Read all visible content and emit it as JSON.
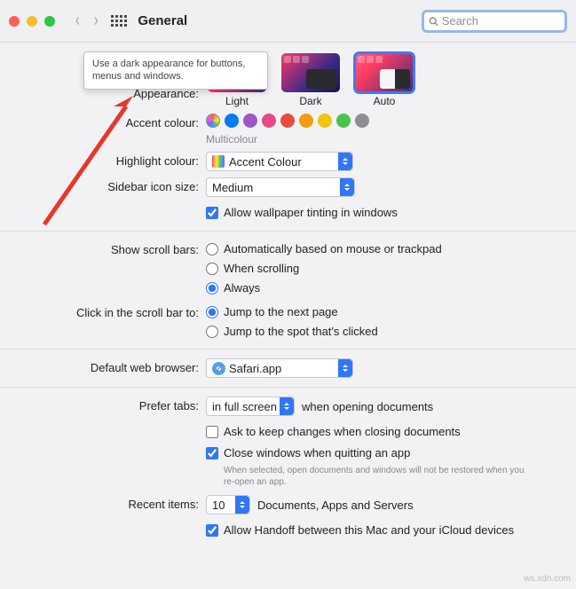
{
  "titlebar": {
    "title": "General"
  },
  "search": {
    "placeholder": "Search"
  },
  "tooltip": "Use a dark appearance for buttons, menus and windows.",
  "labels": {
    "appearance": "Appearance:",
    "accent": "Accent colour:",
    "highlight": "Highlight colour:",
    "iconsize": "Sidebar icon size:",
    "scrollbars": "Show scroll bars:",
    "click": "Click in the scroll bar to:",
    "browser": "Default web browser:",
    "tabs": "Prefer tabs:",
    "recent": "Recent items:"
  },
  "appearance": {
    "light": "Light",
    "dark": "Dark",
    "auto": "Auto"
  },
  "accent_subtext": "Multicolour",
  "highlight_value": "Accent Colour",
  "iconsize_value": "Medium",
  "chk": {
    "wallpaper": "Allow wallpaper tinting in windows",
    "ask": "Ask to keep changes when closing documents",
    "close_windows": "Close windows when quitting an app",
    "close_sub": "When selected, open documents and windows will not be restored when you re-open an app.",
    "handoff": "Allow Handoff between this Mac and your iCloud devices"
  },
  "scroll": {
    "auto": "Automatically based on mouse or trackpad",
    "scrolling": "When scrolling",
    "always": "Always"
  },
  "clickopts": {
    "jump_next": "Jump to the next page",
    "jump_spot": "Jump to the spot that's clicked"
  },
  "browser_value": "Safari.app",
  "tabs_value": "in full screen",
  "tabs_after": "when opening documents",
  "recent_value": "10",
  "recent_after": "Documents, Apps and Servers",
  "watermark": "ws.xdn.com"
}
